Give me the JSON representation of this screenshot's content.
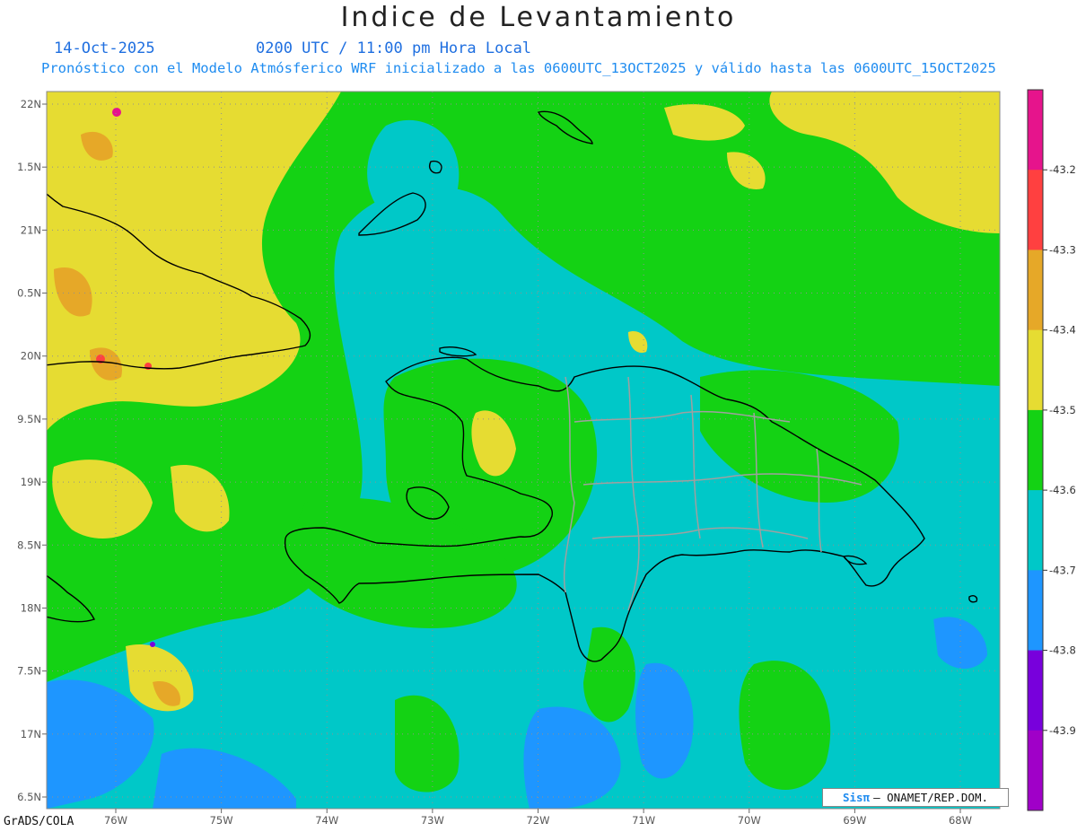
{
  "title": "Indice de Levantamiento",
  "date": "14-Oct-2025",
  "time_text": "0200 UTC / 11:00 pm Hora Local",
  "forecast_text": "Pronóstico con el Modelo Atmósferico WRF inicializado a las 0600UTC_13OCT2025 y válido hasta las  0600UTC_15OCT2025",
  "software": "GrADS/COLA",
  "credit_logo": "Sisπ",
  "credit_text": "– ONAMET/REP.DOM.",
  "map": {
    "lon_range": [
      -76.2,
      -67.6
    ],
    "lat_range": [
      16.4,
      22.1
    ],
    "lon_ticks": [
      {
        "value": -76,
        "label": "76W"
      },
      {
        "value": -75,
        "label": "75W"
      },
      {
        "value": -74,
        "label": "74W"
      },
      {
        "value": -73,
        "label": "73W"
      },
      {
        "value": -72,
        "label": "72W"
      },
      {
        "value": -71,
        "label": "71W"
      },
      {
        "value": -70,
        "label": "70W"
      },
      {
        "value": -69,
        "label": "69W"
      },
      {
        "value": -68,
        "label": "68W"
      }
    ],
    "lat_ticks": [
      {
        "value": 22,
        "label": "22N"
      },
      {
        "value": 21.5,
        "label": "1.5N"
      },
      {
        "value": 21,
        "label": "21N"
      },
      {
        "value": 20.5,
        "label": "0.5N"
      },
      {
        "value": 20,
        "label": "20N"
      },
      {
        "value": 19.5,
        "label": "9.5N"
      },
      {
        "value": 19,
        "label": "19N"
      },
      {
        "value": 18.5,
        "label": "8.5N"
      },
      {
        "value": 18,
        "label": "18N"
      },
      {
        "value": 17.5,
        "label": "7.5N"
      },
      {
        "value": 17,
        "label": "17N"
      },
      {
        "value": 16.5,
        "label": "6.5N"
      }
    ],
    "grid": true
  },
  "colorbar": {
    "labels": [
      "-43.2",
      "-43.3",
      "-43.4",
      "-43.5",
      "-43.6",
      "-43.7",
      "-43.8",
      "-43.9"
    ],
    "colors": [
      "#e6148c",
      "#ff4040",
      "#e6a828",
      "#e6dc32",
      "#14d214",
      "#00c8c8",
      "#1e96ff",
      "#7800dc",
      "#a000c8"
    ]
  },
  "colors": {
    "green": "#14d214",
    "cyan": "#00c8c8",
    "yellow": "#e6dc32",
    "orange": "#e6a828",
    "blue": "#1e96ff",
    "coast": "#000000",
    "provinces": "#a0a0a0",
    "grid": "#909090"
  }
}
